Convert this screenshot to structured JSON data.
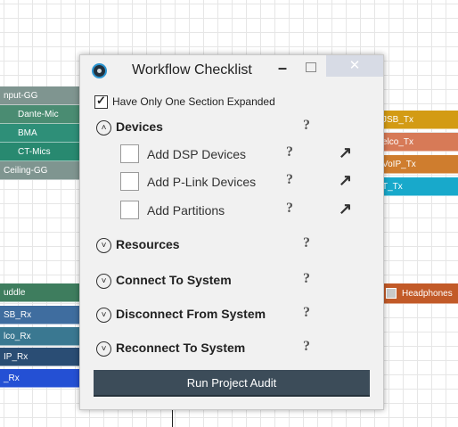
{
  "canvas": {
    "left_blocks": [
      {
        "label": "nput-GG",
        "color": "#7f9590"
      },
      {
        "label": "Dante-Mic",
        "color": "#4a8c72"
      },
      {
        "label": "BMA",
        "color": "#2e8f78"
      },
      {
        "label": "CT-Mics",
        "color": "#288970"
      },
      {
        "label": "Ceiling-GG",
        "color": "#7f9590"
      },
      {
        "label": "uddle",
        "color": "#3e7d5e"
      },
      {
        "label": "SB_Rx",
        "color": "#3f6d9f"
      },
      {
        "label": "lco_Rx",
        "color": "#3a7891"
      },
      {
        "label": "IP_Rx",
        "color": "#2a4d74"
      },
      {
        "label": "_Rx",
        "color": "#2450d4"
      }
    ],
    "right_blocks": [
      {
        "label": "JSB_Tx",
        "color": "#d39b14"
      },
      {
        "label": "elco_Tx",
        "color": "#d77a57"
      },
      {
        "label": "VoIP_Tx",
        "color": "#cf7d2e"
      },
      {
        "label": "T_Tx",
        "color": "#18a9cb"
      },
      {
        "label": "Headphones",
        "color": "#c25a28",
        "icon": "headphones-icon"
      }
    ]
  },
  "window": {
    "title": "Workflow Checklist",
    "minimize": "–",
    "close": "✕",
    "option": {
      "label": "Have Only One Section Expanded",
      "checked": true
    },
    "help_glyph": "?",
    "expanded_glyph": "˄",
    "collapsed_glyph": "˅",
    "goto_glyph": "↗",
    "sections": [
      {
        "label": "Devices",
        "expanded": true
      },
      {
        "label": "Resources",
        "expanded": false
      },
      {
        "label": "Connect To System",
        "expanded": false
      },
      {
        "label": "Disconnect From System",
        "expanded": false
      },
      {
        "label": "Reconnect To System",
        "expanded": false
      }
    ],
    "device_items": [
      {
        "label": "Add DSP Devices",
        "checked": false
      },
      {
        "label": "Add P-Link Devices",
        "checked": false
      },
      {
        "label": "Add Partitions",
        "checked": false
      }
    ],
    "audit_button": "Run Project Audit"
  }
}
